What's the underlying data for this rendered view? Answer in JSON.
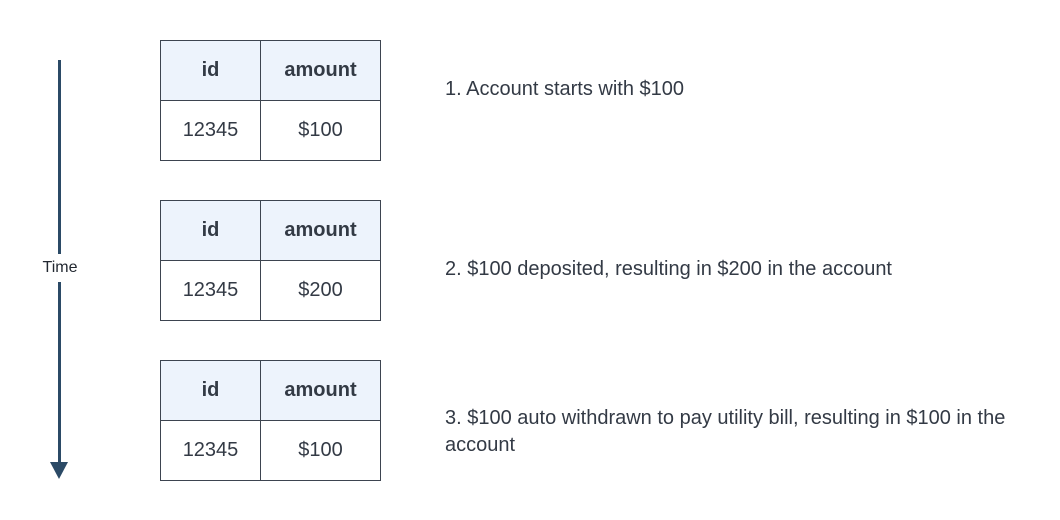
{
  "timeline": {
    "label": "Time",
    "color": "#2b4a66"
  },
  "colors": {
    "header_fill": "#edf3fc",
    "border": "#3d4450",
    "text": "#333a45"
  },
  "steps": [
    {
      "table": {
        "headers": [
          "id",
          "amount"
        ],
        "row": [
          "12345",
          "$100"
        ]
      },
      "note": "1. Account starts with $100"
    },
    {
      "table": {
        "headers": [
          "id",
          "amount"
        ],
        "row": [
          "12345",
          "$200"
        ]
      },
      "note": "2. $100 deposited, resulting in $200 in the account"
    },
    {
      "table": {
        "headers": [
          "id",
          "amount"
        ],
        "row": [
          "12345",
          "$100"
        ]
      },
      "note": "3. $100 auto withdrawn to pay utility bill, resulting in $100 in the account"
    }
  ]
}
